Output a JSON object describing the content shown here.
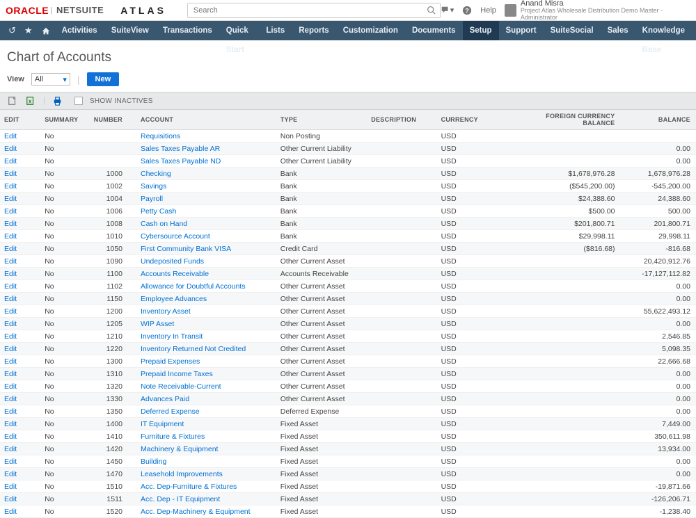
{
  "header": {
    "oracle": "ORACLE",
    "netsuite": "NETSUITE",
    "atlas": "ATLAS",
    "search_placeholder": "Search",
    "help": "Help",
    "user_name": "Anand Misra",
    "user_role": "Project Atlas Wholesale Distribution Demo Master - Administrator"
  },
  "nav": {
    "items": [
      "Activities",
      "SuiteView",
      "Transactions",
      "Quick Start",
      "Lists",
      "Reports",
      "Customization",
      "Documents",
      "Setup",
      "Support",
      "SuiteSocial",
      "Sales",
      "Knowledge Base"
    ],
    "active_index": 8
  },
  "page": {
    "title": "Chart of Accounts",
    "view_label": "View",
    "view_value": "All",
    "new_button": "New",
    "show_inactives": "SHOW INACTIVES"
  },
  "table": {
    "headers": {
      "edit": "EDIT",
      "summary": "SUMMARY",
      "number": "NUMBER",
      "account": "ACCOUNT",
      "type": "TYPE",
      "description": "DESCRIPTION",
      "currency": "CURRENCY",
      "fcb": "FOREIGN CURRENCY BALANCE",
      "balance": "BALANCE"
    },
    "rows": [
      {
        "edit": "Edit",
        "summary": "No",
        "number": "",
        "account": "Requisitions",
        "type": "Non Posting",
        "description": "",
        "currency": "USD",
        "fcb": "",
        "balance": ""
      },
      {
        "edit": "Edit",
        "summary": "No",
        "number": "",
        "account": "Sales Taxes Payable AR",
        "type": "Other Current Liability",
        "description": "",
        "currency": "USD",
        "fcb": "",
        "balance": "0.00"
      },
      {
        "edit": "Edit",
        "summary": "No",
        "number": "",
        "account": "Sales Taxes Payable ND",
        "type": "Other Current Liability",
        "description": "",
        "currency": "USD",
        "fcb": "",
        "balance": "0.00"
      },
      {
        "edit": "Edit",
        "summary": "No",
        "number": "1000",
        "account": "Checking",
        "type": "Bank",
        "description": "",
        "currency": "USD",
        "fcb": "$1,678,976.28",
        "balance": "1,678,976.28"
      },
      {
        "edit": "Edit",
        "summary": "No",
        "number": "1002",
        "account": "Savings",
        "type": "Bank",
        "description": "",
        "currency": "USD",
        "fcb": "($545,200.00)",
        "balance": "-545,200.00"
      },
      {
        "edit": "Edit",
        "summary": "No",
        "number": "1004",
        "account": "Payroll",
        "type": "Bank",
        "description": "",
        "currency": "USD",
        "fcb": "$24,388.60",
        "balance": "24,388.60"
      },
      {
        "edit": "Edit",
        "summary": "No",
        "number": "1006",
        "account": "Petty Cash",
        "type": "Bank",
        "description": "",
        "currency": "USD",
        "fcb": "$500.00",
        "balance": "500.00"
      },
      {
        "edit": "Edit",
        "summary": "No",
        "number": "1008",
        "account": "Cash on Hand",
        "type": "Bank",
        "description": "",
        "currency": "USD",
        "fcb": "$201,800.71",
        "balance": "201,800.71"
      },
      {
        "edit": "Edit",
        "summary": "No",
        "number": "1010",
        "account": "Cybersource Account",
        "type": "Bank",
        "description": "",
        "currency": "USD",
        "fcb": "$29,998.11",
        "balance": "29,998.11"
      },
      {
        "edit": "Edit",
        "summary": "No",
        "number": "1050",
        "account": "First Community Bank VISA",
        "type": "Credit Card",
        "description": "",
        "currency": "USD",
        "fcb": "($816.68)",
        "balance": "-816.68"
      },
      {
        "edit": "Edit",
        "summary": "No",
        "number": "1090",
        "account": "Undeposited Funds",
        "type": "Other Current Asset",
        "description": "",
        "currency": "USD",
        "fcb": "",
        "balance": "20,420,912.76"
      },
      {
        "edit": "Edit",
        "summary": "No",
        "number": "1100",
        "account": "Accounts Receivable",
        "type": "Accounts Receivable",
        "description": "",
        "currency": "USD",
        "fcb": "",
        "balance": "-17,127,112.82"
      },
      {
        "edit": "Edit",
        "summary": "No",
        "number": "1102",
        "account": "Allowance for Doubtful Accounts",
        "type": "Other Current Asset",
        "description": "",
        "currency": "USD",
        "fcb": "",
        "balance": "0.00"
      },
      {
        "edit": "Edit",
        "summary": "No",
        "number": "1150",
        "account": "Employee Advances",
        "type": "Other Current Asset",
        "description": "",
        "currency": "USD",
        "fcb": "",
        "balance": "0.00"
      },
      {
        "edit": "Edit",
        "summary": "No",
        "number": "1200",
        "account": "Inventory Asset",
        "type": "Other Current Asset",
        "description": "",
        "currency": "USD",
        "fcb": "",
        "balance": "55,622,493.12"
      },
      {
        "edit": "Edit",
        "summary": "No",
        "number": "1205",
        "account": "WIP Asset",
        "type": "Other Current Asset",
        "description": "",
        "currency": "USD",
        "fcb": "",
        "balance": "0.00"
      },
      {
        "edit": "Edit",
        "summary": "No",
        "number": "1210",
        "account": "Inventory In Transit",
        "type": "Other Current Asset",
        "description": "",
        "currency": "USD",
        "fcb": "",
        "balance": "2,546.85"
      },
      {
        "edit": "Edit",
        "summary": "No",
        "number": "1220",
        "account": "Inventory Returned Not Credited",
        "type": "Other Current Asset",
        "description": "",
        "currency": "USD",
        "fcb": "",
        "balance": "5,098.35"
      },
      {
        "edit": "Edit",
        "summary": "No",
        "number": "1300",
        "account": "Prepaid Expenses",
        "type": "Other Current Asset",
        "description": "",
        "currency": "USD",
        "fcb": "",
        "balance": "22,666.68"
      },
      {
        "edit": "Edit",
        "summary": "No",
        "number": "1310",
        "account": "Prepaid Income Taxes",
        "type": "Other Current Asset",
        "description": "",
        "currency": "USD",
        "fcb": "",
        "balance": "0.00"
      },
      {
        "edit": "Edit",
        "summary": "No",
        "number": "1320",
        "account": "Note Receivable-Current",
        "type": "Other Current Asset",
        "description": "",
        "currency": "USD",
        "fcb": "",
        "balance": "0.00"
      },
      {
        "edit": "Edit",
        "summary": "No",
        "number": "1330",
        "account": "Advances Paid",
        "type": "Other Current Asset",
        "description": "",
        "currency": "USD",
        "fcb": "",
        "balance": "0.00"
      },
      {
        "edit": "Edit",
        "summary": "No",
        "number": "1350",
        "account": "Deferred Expense",
        "type": "Deferred Expense",
        "description": "",
        "currency": "USD",
        "fcb": "",
        "balance": "0.00"
      },
      {
        "edit": "Edit",
        "summary": "No",
        "number": "1400",
        "account": "IT Equipment",
        "type": "Fixed Asset",
        "description": "",
        "currency": "USD",
        "fcb": "",
        "balance": "7,449.00"
      },
      {
        "edit": "Edit",
        "summary": "No",
        "number": "1410",
        "account": "Furniture & Fixtures",
        "type": "Fixed Asset",
        "description": "",
        "currency": "USD",
        "fcb": "",
        "balance": "350,611.98"
      },
      {
        "edit": "Edit",
        "summary": "No",
        "number": "1420",
        "account": "Machinery & Equipment",
        "type": "Fixed Asset",
        "description": "",
        "currency": "USD",
        "fcb": "",
        "balance": "13,934.00"
      },
      {
        "edit": "Edit",
        "summary": "No",
        "number": "1450",
        "account": "Building",
        "type": "Fixed Asset",
        "description": "",
        "currency": "USD",
        "fcb": "",
        "balance": "0.00"
      },
      {
        "edit": "Edit",
        "summary": "No",
        "number": "1470",
        "account": "Leasehold Improvements",
        "type": "Fixed Asset",
        "description": "",
        "currency": "USD",
        "fcb": "",
        "balance": "0.00"
      },
      {
        "edit": "Edit",
        "summary": "No",
        "number": "1510",
        "account": "Acc. Dep-Furniture & Fixtures",
        "type": "Fixed Asset",
        "description": "",
        "currency": "USD",
        "fcb": "",
        "balance": "-19,871.66"
      },
      {
        "edit": "Edit",
        "summary": "No",
        "number": "1511",
        "account": "Acc. Dep - IT Equipment",
        "type": "Fixed Asset",
        "description": "",
        "currency": "USD",
        "fcb": "",
        "balance": "-126,206.71"
      },
      {
        "edit": "Edit",
        "summary": "No",
        "number": "1520",
        "account": "Acc. Dep-Machinery & Equipment",
        "type": "Fixed Asset",
        "description": "",
        "currency": "USD",
        "fcb": "",
        "balance": "-1,238.40"
      }
    ]
  }
}
